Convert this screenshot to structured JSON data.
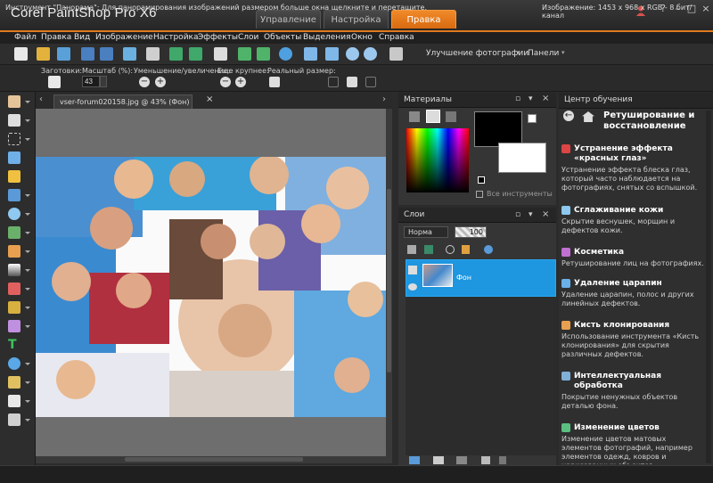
{
  "app": {
    "title": "Corel PaintShop Pro X6"
  },
  "workspace_tabs": [
    {
      "label": "Управление",
      "active": false
    },
    {
      "label": "Настройка",
      "active": false
    },
    {
      "label": "Правка",
      "active": true
    }
  ],
  "menu": [
    "Файл",
    "Правка",
    "Вид",
    "Изображение",
    "Настройка",
    "Эффекты",
    "Слои",
    "Объекты",
    "Выделения",
    "Окно",
    "Справка"
  ],
  "toolbar": {
    "enhance_label": "Улучшение фотографии",
    "panels_label": "Панели"
  },
  "options": {
    "preset_label": "Заготовки:",
    "zoom_label": "Масштаб (%):",
    "zoom_value": "43",
    "zoom_inout_label": "Уменьшение/увеличение:",
    "zoom_more_label": "Еще крупнее:",
    "actual_size_label": "Реальный размер:"
  },
  "document": {
    "tab_label": "vser-forum020158.jpg @ 43% (Фон)"
  },
  "materials": {
    "title": "Материалы",
    "all_tools_label": "Все инструменты"
  },
  "layers": {
    "title": "Слои",
    "blend_mode": "Норма",
    "opacity": "100",
    "layer_name": "Фон"
  },
  "learning": {
    "title": "Центр обучения",
    "section": "Ретуширование и восстановление",
    "items": [
      {
        "title": "Устранение эффекта «красных глаз»",
        "desc": "Устранение эффекта блеска глаз, который часто наблюдается на фотографиях, снятых со вспышкой."
      },
      {
        "title": "Сглаживание кожи",
        "desc": "Скрытие веснушек, морщин и дефектов кожи."
      },
      {
        "title": "Косметика",
        "desc": "Ретуширование лиц на фотографиях."
      },
      {
        "title": "Удаление царапин",
        "desc": "Удаление царапин, полос и других линейных дефектов."
      },
      {
        "title": "Кисть клонирования",
        "desc": "Использование инструмента «Кисть клонирования» для скрытия различных дефектов."
      },
      {
        "title": "Интеллектуальная обработка",
        "desc": "Покрытие ненужных объектов деталью фона."
      },
      {
        "title": "Изменение цветов",
        "desc": "Изменение цветов матовых элементов фотографий, например элементов одежд, ковров и нарисованных объектов."
      }
    ]
  },
  "status": {
    "text": "Инструмент \"Панорама\": Для панорамирования изображений размером больше окна щелкните и перетащите.",
    "image_info": "Изображение:  1453 x 968 x RGB - 8 бит/канал"
  },
  "colors": {
    "accent": "#e07a1f",
    "selection": "#1e96e0"
  }
}
